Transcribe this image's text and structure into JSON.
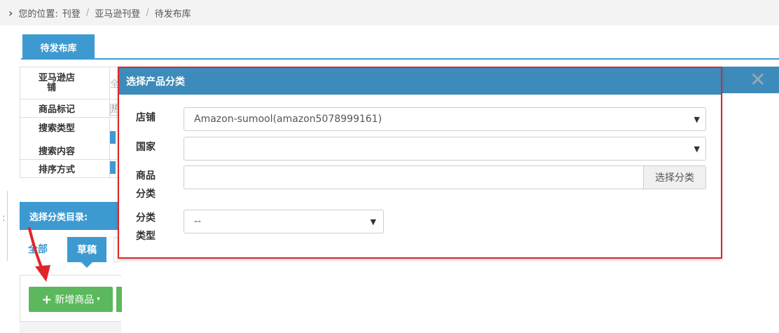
{
  "breadcrumb": {
    "prefix": "您的位置:",
    "items": [
      "刊登",
      "亚马逊刊登",
      "待发布库"
    ],
    "separator": "/"
  },
  "tab": {
    "label": "待发布库"
  },
  "filters": {
    "store_label_line1": "亚马逊店",
    "store_label_line2": "铺",
    "store_value_char": "全",
    "tag_label": "商品标记",
    "tag_value_char": "热",
    "search_type_label": "搜索类型",
    "search_content_label": "搜索内容",
    "sort_label": "排序方式"
  },
  "category_dir": {
    "label": "选择分类目录:"
  },
  "status_tabs": {
    "all": "全部",
    "draft": "草稿"
  },
  "actions": {
    "add_product": "新增商品",
    "plus": "+",
    "caret": "▾"
  },
  "modal": {
    "title": "选择产品分类",
    "close": "✕",
    "store_label": "店铺",
    "store_value": "Amazon-sumool(amazon5078999161)",
    "country_label": "国家",
    "country_value": "",
    "category_label_line1": "商品",
    "category_label_line2": "分类",
    "choose_category_button": "选择分类",
    "category_type_label_line1": "分类",
    "category_type_label_line2": "类型",
    "category_type_value": "--",
    "select_caret": "▼"
  },
  "colors": {
    "primary": "#3d9ad1",
    "modal_header": "#3d8bbb",
    "highlight_border": "#e0262b",
    "success": "#5cb85c"
  }
}
